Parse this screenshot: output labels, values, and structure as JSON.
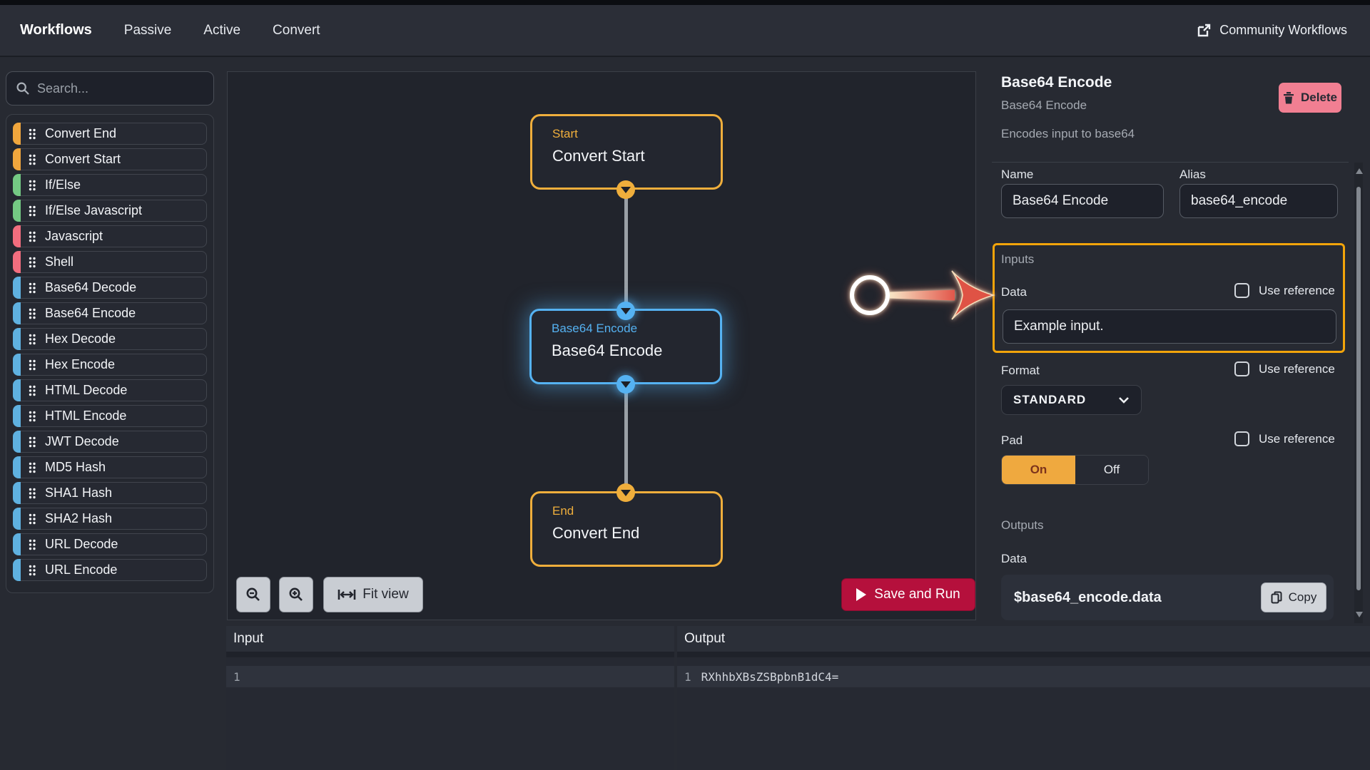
{
  "nav": {
    "brand": "Workflows",
    "items": [
      "Passive",
      "Active",
      "Convert"
    ],
    "community": "Community Workflows"
  },
  "sidebar": {
    "search_placeholder": "Search...",
    "items": [
      {
        "label": "Convert End",
        "color": "#f0a63d"
      },
      {
        "label": "Convert Start",
        "color": "#f0a63d"
      },
      {
        "label": "If/Else",
        "color": "#74c983"
      },
      {
        "label": "If/Else Javascript",
        "color": "#74c983"
      },
      {
        "label": "Javascript",
        "color": "#f26d7e"
      },
      {
        "label": "Shell",
        "color": "#f26d7e"
      },
      {
        "label": "Base64 Decode",
        "color": "#5fb1e0"
      },
      {
        "label": "Base64 Encode",
        "color": "#5fb1e0"
      },
      {
        "label": "Hex Decode",
        "color": "#5fb1e0"
      },
      {
        "label": "Hex Encode",
        "color": "#5fb1e0"
      },
      {
        "label": "HTML Decode",
        "color": "#5fb1e0"
      },
      {
        "label": "HTML Encode",
        "color": "#5fb1e0"
      },
      {
        "label": "JWT Decode",
        "color": "#5fb1e0"
      },
      {
        "label": "MD5 Hash",
        "color": "#5fb1e0"
      },
      {
        "label": "SHA1 Hash",
        "color": "#5fb1e0"
      },
      {
        "label": "SHA2 Hash",
        "color": "#5fb1e0"
      },
      {
        "label": "URL Decode",
        "color": "#5fb1e0"
      },
      {
        "label": "URL Encode",
        "color": "#5fb1e0"
      }
    ]
  },
  "canvas": {
    "nodes": [
      {
        "type": "Start",
        "name": "Convert Start",
        "color": "#efae3c",
        "selected": false
      },
      {
        "type": "Base64 Encode",
        "name": "Base64 Encode",
        "color": "#55b2f2",
        "selected": true
      },
      {
        "type": "End",
        "name": "Convert End",
        "color": "#efae3c",
        "selected": false
      }
    ],
    "controls": {
      "fit_view": "Fit view",
      "save_and_run": "Save and Run"
    }
  },
  "inspector": {
    "title": "Base64 Encode",
    "subtitle": "Base64 Encode",
    "description": "Encodes input to base64",
    "delete_label": "Delete",
    "name_label": "Name",
    "name_value": "Base64 Encode",
    "alias_label": "Alias",
    "alias_value": "base64_encode",
    "inputs_label": "Inputs",
    "data_label": "Data",
    "use_reference_label": "Use reference",
    "data_value": "Example input.",
    "format_label": "Format",
    "format_value": "STANDARD",
    "pad_label": "Pad",
    "pad_on": "On",
    "pad_off": "Off",
    "outputs_label": "Outputs",
    "output_data_label": "Data",
    "output_value": "$base64_encode.data",
    "copy_label": "Copy"
  },
  "io": {
    "input": {
      "title": "Input",
      "lines": [
        {
          "number": "1",
          "text": ""
        }
      ]
    },
    "output": {
      "title": "Output",
      "lines": [
        {
          "number": "1",
          "text": "RXhhbXBsZSBpbnB1dC4="
        }
      ]
    }
  }
}
